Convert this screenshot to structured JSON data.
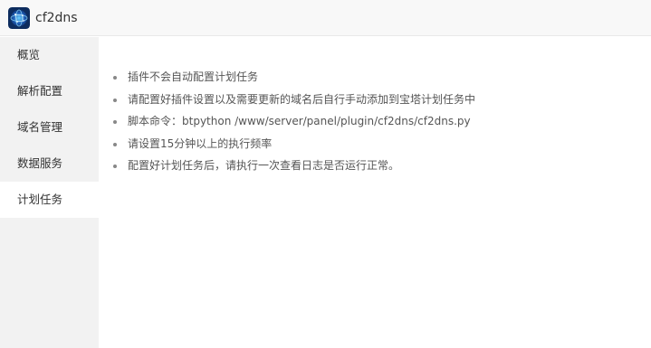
{
  "app": {
    "title": "cf2dns",
    "icon": "cf2dns-globe-icon"
  },
  "sidebar": {
    "items": [
      {
        "label": "概览",
        "active": false
      },
      {
        "label": "解析配置",
        "active": false
      },
      {
        "label": "域名管理",
        "active": false
      },
      {
        "label": "数据服务",
        "active": false
      },
      {
        "label": "计划任务",
        "active": true
      }
    ]
  },
  "main": {
    "tips": [
      "插件不会自动配置计划任务",
      "请配置好插件设置以及需要更新的域名后自行手动添加到宝塔计划任务中",
      "脚本命令：btpython /www/server/panel/plugin/cf2dns/cf2dns.py",
      "请设置15分钟以上的执行频率",
      "配置好计划任务后，请执行一次查看日志是否运行正常。"
    ]
  },
  "colors": {
    "titlebar_bg": "#f8f8f8",
    "sidebar_bg": "#f2f2f2",
    "active_item_bg": "#ffffff",
    "text": "#333333"
  }
}
